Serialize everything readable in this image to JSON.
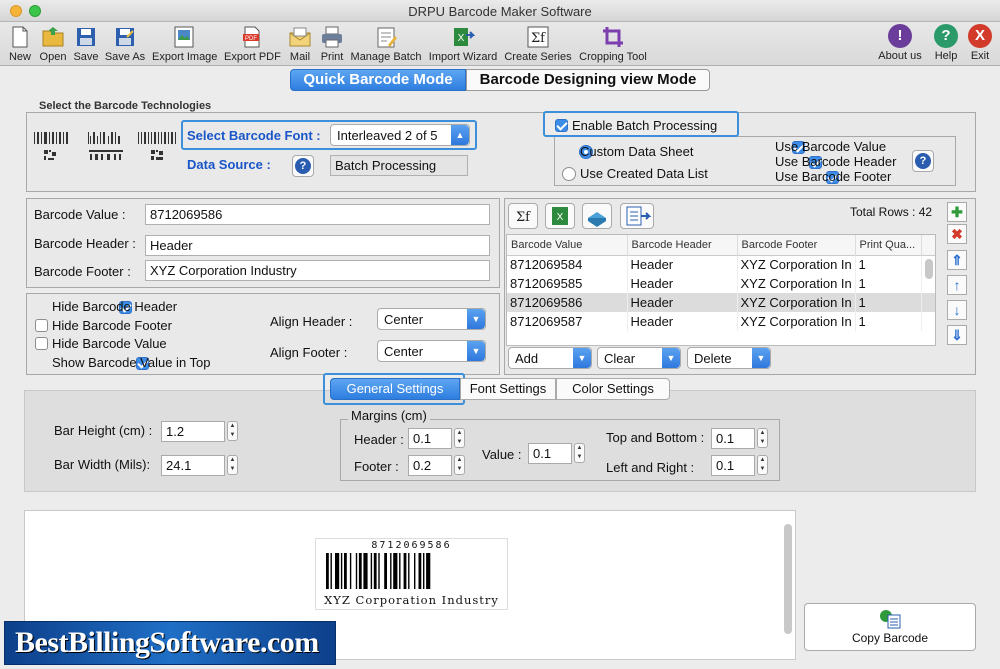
{
  "window": {
    "title": "DRPU Barcode Maker Software"
  },
  "toolbar": [
    {
      "label": "New",
      "icon": "new-file-icon"
    },
    {
      "label": "Open",
      "icon": "open-folder-icon"
    },
    {
      "label": "Save",
      "icon": "save-icon"
    },
    {
      "label": "Save As",
      "icon": "save-as-icon"
    },
    {
      "label": "Export Image",
      "icon": "export-image-icon"
    },
    {
      "label": "Export PDF",
      "icon": "export-pdf-icon"
    },
    {
      "label": "Mail",
      "icon": "mail-icon"
    },
    {
      "label": "Print",
      "icon": "printer-icon"
    },
    {
      "label": "Manage Batch",
      "icon": "manage-batch-icon"
    },
    {
      "label": "Import Wizard",
      "icon": "import-wizard-icon"
    },
    {
      "label": "Create Series",
      "icon": "create-series-icon"
    },
    {
      "label": "Cropping Tool",
      "icon": "crop-icon"
    }
  ],
  "toolbar_right": [
    {
      "label": "About us",
      "glyph": "!",
      "color": "#6a3d9a"
    },
    {
      "label": "Help",
      "glyph": "?",
      "color": "#2a9a6a"
    },
    {
      "label": "Exit",
      "glyph": "X",
      "color": "#d23a2a"
    }
  ],
  "modes": {
    "quick": "Quick Barcode Mode",
    "designing": "Barcode Designing view Mode"
  },
  "technologies": {
    "group_title": "Select the Barcode Technologies",
    "font_label": "Select Barcode Font :",
    "font_value": "Interleaved 2 of 5",
    "source_label": "Data Source :",
    "source_value": "Batch Processing"
  },
  "batch": {
    "enable_label": "Enable Batch Processing",
    "enabled": true,
    "custom_sheet": "Custom Data Sheet",
    "created_list": "Use Created Data List",
    "use_value": "Use Barcode Value",
    "use_header": "Use Barcode Header",
    "use_footer": "Use Barcode Footer"
  },
  "fields": {
    "value_label": "Barcode Value :",
    "value": "8712069586",
    "header_label": "Barcode Header :",
    "header": "Header",
    "footer_label": "Barcode Footer :",
    "footer": "XYZ Corporation Industry"
  },
  "table": {
    "total_rows_label": "Total Rows : 42",
    "columns": [
      "Barcode Value",
      "Barcode Header",
      "Barcode Footer",
      "Print Qua..."
    ],
    "rows": [
      [
        "8712069584",
        "Header",
        "XYZ Corporation In",
        "1"
      ],
      [
        "8712069585",
        "Header",
        "XYZ Corporation In",
        "1"
      ],
      [
        "8712069586",
        "Header",
        "XYZ Corporation In",
        "1"
      ],
      [
        "8712069587",
        "Header",
        "XYZ Corporation In",
        "1"
      ]
    ],
    "add_label": "Add",
    "clear_label": "Clear",
    "delete_label": "Delete"
  },
  "options": {
    "hide_header": "Hide Barcode Header",
    "hide_footer": "Hide Barcode Footer",
    "hide_value": "Hide Barcode Value",
    "show_top": "Show Barcode Value in Top",
    "align_header_label": "Align Header :",
    "align_header": "Center",
    "align_footer_label": "Align Footer :",
    "align_footer": "Center"
  },
  "settings_tabs": [
    "General Settings",
    "Font Settings",
    "Color Settings"
  ],
  "general": {
    "bar_height_label": "Bar Height (cm) :",
    "bar_height": "1.2",
    "bar_width_label": "Bar Width (Mils):",
    "bar_width": "24.1",
    "margins_title": "Margins (cm)",
    "header_label": "Header :",
    "header": "0.1",
    "footer_label": "Footer :",
    "footer": "0.2",
    "value_label": "Value :",
    "value": "0.1",
    "top_bottom_label": "Top and Bottom :",
    "top_bottom": "0.1",
    "left_right_label": "Left and Right :",
    "left_right": "0.1"
  },
  "preview": {
    "value_text": "8712069586",
    "footer_text": "XYZ Corporation Industry"
  },
  "copy_label": "Copy Barcode",
  "watermark": "BestBillingSoftware.com"
}
